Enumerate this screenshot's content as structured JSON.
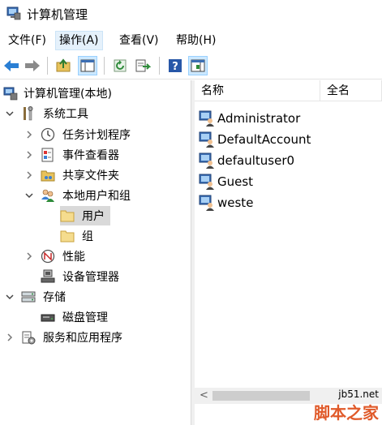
{
  "window": {
    "title": "计算机管理"
  },
  "menu": {
    "items": [
      {
        "label": "文件(F)"
      },
      {
        "label": "操作(A)"
      },
      {
        "label": "查看(V)"
      },
      {
        "label": "帮助(H)"
      }
    ]
  },
  "tree": {
    "items": [
      {
        "label": "计算机管理(本地)"
      },
      {
        "label": "系统工具"
      },
      {
        "label": "任务计划程序"
      },
      {
        "label": "事件查看器"
      },
      {
        "label": "共享文件夹"
      },
      {
        "label": "本地用户和组"
      },
      {
        "label": "用户"
      },
      {
        "label": "组"
      },
      {
        "label": "性能"
      },
      {
        "label": "设备管理器"
      },
      {
        "label": "存储"
      },
      {
        "label": "磁盘管理"
      },
      {
        "label": "服务和应用程序"
      }
    ]
  },
  "list": {
    "columns": [
      {
        "label": "名称"
      },
      {
        "label": "全名"
      }
    ],
    "rows": [
      {
        "name": "Administrator"
      },
      {
        "name": "DefaultAccount"
      },
      {
        "name": "defaultuser0"
      },
      {
        "name": "Guest"
      },
      {
        "name": "weste"
      }
    ]
  },
  "watermark": {
    "url": "jb51.net",
    "name": "脚本之家"
  },
  "colors": {
    "selection": "#d9d9d9",
    "accent": "#0078d7",
    "watermark": "#e05a2a"
  }
}
